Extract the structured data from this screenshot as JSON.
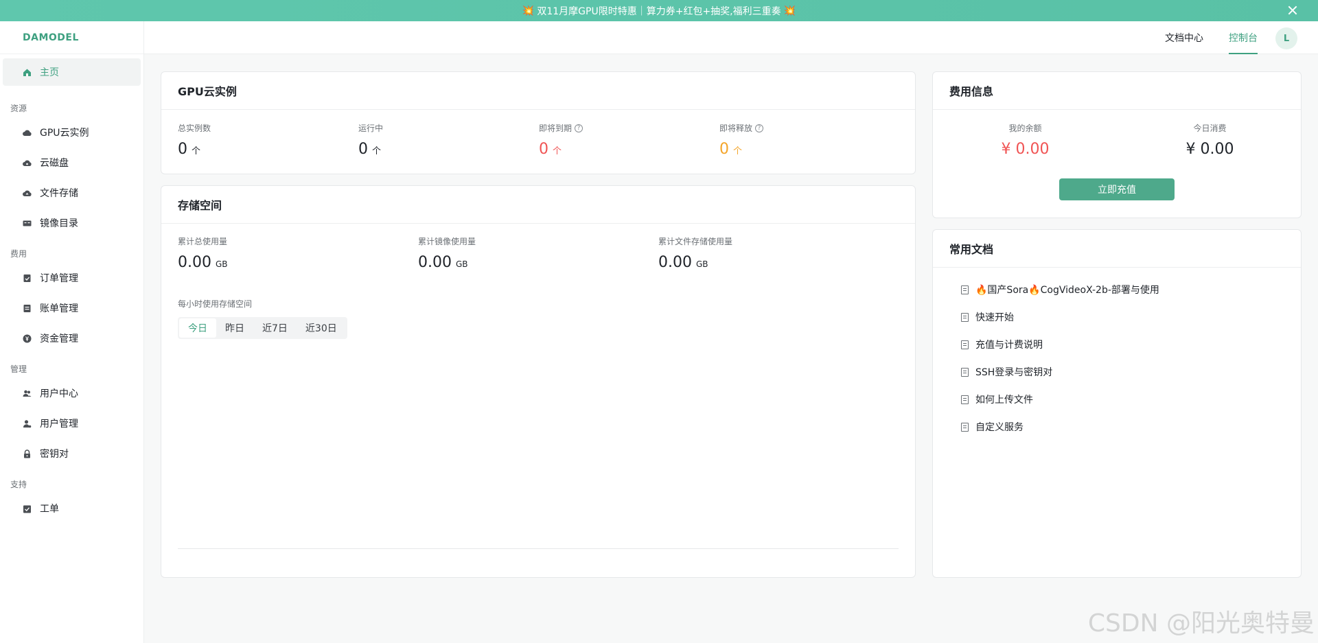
{
  "banner": {
    "text": "双11月摩GPU限时特惠｜算力券+红包+抽奖,福利三重奏",
    "bang_left": "💥",
    "bang_right": "💥"
  },
  "sidebar": {
    "logo": "DAMODEL",
    "home": "主页",
    "groups": [
      {
        "label": "资源",
        "items": [
          "GPU云实例",
          "云磁盘",
          "文件存储",
          "镜像目录"
        ]
      },
      {
        "label": "费用",
        "items": [
          "订单管理",
          "账单管理",
          "资金管理"
        ]
      },
      {
        "label": "管理",
        "items": [
          "用户中心",
          "用户管理",
          "密钥对"
        ]
      },
      {
        "label": "支持",
        "items": [
          "工单"
        ]
      }
    ]
  },
  "topbar": {
    "docs": "文档中心",
    "console": "控制台",
    "avatar": "L"
  },
  "gpu": {
    "title": "GPU云实例",
    "stats": [
      {
        "label": "总实例数",
        "value": "0",
        "unit": "个"
      },
      {
        "label": "运行中",
        "value": "0",
        "unit": "个"
      },
      {
        "label": "即将到期",
        "value": "0",
        "unit": "个",
        "help": "?"
      },
      {
        "label": "即将释放",
        "value": "0",
        "unit": "个",
        "help": "?"
      }
    ]
  },
  "storage": {
    "title": "存储空间",
    "stats": [
      {
        "label": "累计总使用量",
        "value": "0.00",
        "unit": "GB"
      },
      {
        "label": "累计镜像使用量",
        "value": "0.00",
        "unit": "GB"
      },
      {
        "label": "累计文件存储使用量",
        "value": "0.00",
        "unit": "GB"
      }
    ],
    "chart_label": "每小时使用存储空间",
    "tabs": [
      "今日",
      "昨日",
      "近7日",
      "近30日"
    ]
  },
  "billing": {
    "title": "费用信息",
    "balance_label": "我的余额",
    "balance_value": "¥ 0.00",
    "today_label": "今日消费",
    "today_value": "¥ 0.00",
    "recharge": "立即充值"
  },
  "docs": {
    "title": "常用文档",
    "items": [
      "🔥国产Sora🔥CogVideoX-2b-部署与使用",
      "快速开始",
      "充值与计费说明",
      "SSH登录与密钥对",
      "如何上传文件",
      "自定义服务"
    ]
  },
  "watermark": "CSDN @阳光奥特曼",
  "colors": {
    "accent": "#3ea080",
    "banner": "#5fc7ad",
    "danger": "#f05454",
    "warning": "#f4a52a"
  }
}
